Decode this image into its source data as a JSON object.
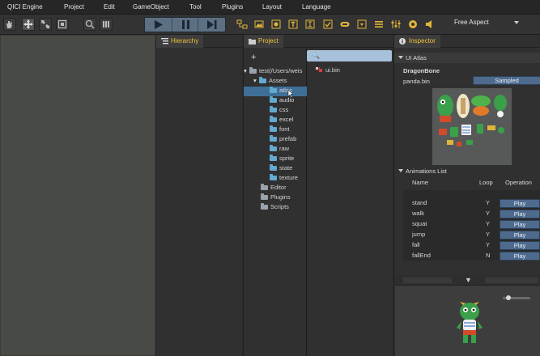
{
  "menubar": {
    "items": [
      "QICI Engine",
      "Project",
      "Edit",
      "GameObject",
      "Tool",
      "Plugins",
      "Layout",
      "Language"
    ]
  },
  "toolbar": {
    "aspect": "Free Aspect"
  },
  "hierarchy": {
    "tab_label": "Hierarchy"
  },
  "project": {
    "tab_label": "Project",
    "add_label": "+",
    "search_value": "🔍",
    "root_label": "test(/Users/weis",
    "assets_label": "Assets",
    "asset_folders": [
      "atlas",
      "audio",
      "css",
      "excel",
      "font",
      "prefab",
      "raw",
      "sprite",
      "state",
      "texture"
    ],
    "other_folders": [
      "Editor",
      "Plugins",
      "Scripts"
    ],
    "file_item": "ui.bin"
  },
  "inspector": {
    "tab_label": "Inspector",
    "section_title": "UI Atlas",
    "asset_type": "DragonBone",
    "file_name": "panda.bin",
    "sampled_label": "Sampled",
    "animations_title": "Animations List",
    "col_name": "Name",
    "col_loop": "Loop",
    "col_operation": "Operation",
    "play_label": "Play",
    "animations": [
      {
        "name": "stand",
        "loop": "Y"
      },
      {
        "name": "walk",
        "loop": "Y"
      },
      {
        "name": "squat",
        "loop": "Y"
      },
      {
        "name": "jump",
        "loop": "Y"
      },
      {
        "name": "fall",
        "loop": "Y"
      },
      {
        "name": "fallEnd",
        "loop": "N"
      }
    ],
    "collapse_arrow": "▼"
  },
  "colors": {
    "accent_tab": "#f0c23a",
    "play_button": "#4e6b8e",
    "selected_row": "#3f6f97"
  }
}
